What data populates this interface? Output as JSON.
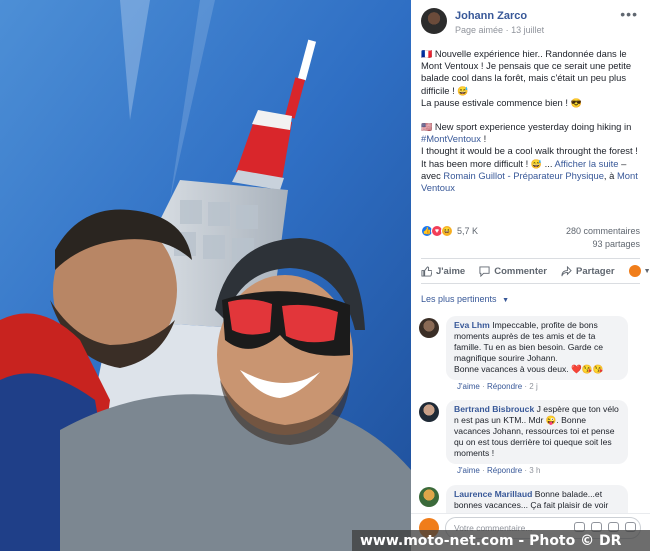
{
  "post": {
    "author": "Johann Zarco",
    "page_label": "Page aimée",
    "date": "13 juillet",
    "more_label": "•••",
    "text": {
      "fr_line1_flag": "🇫🇷",
      "fr_line1": "Nouvelle expérience hier.. Randonnée dans le Mont Ventoux ! Je pensais que ce serait une petite balade cool dans la forêt, mais c'était un peu plus difficile !",
      "fr_emoji1": "😅",
      "fr_line2": "La pause estivale commence bien !",
      "fr_emoji2": "😎",
      "en_flag": "🇺🇸",
      "en_line1": "New sport experience yesterday doing hiking in",
      "hashtag": "#MontVentoux",
      "en_line1_end": "!",
      "en_line2": "I thought it would be a cool walk throught the forest ! It has been more difficult !",
      "en_emoji": "😅",
      "ellipsis": "...",
      "see_more": "Afficher la suite",
      "dash": "–",
      "with_label": "avec",
      "tag1": "Romain Guillot - Préparateur Physique",
      "at_label": ", à",
      "place": "Mont Ventoux"
    }
  },
  "stats": {
    "reactions_count": "5,7 K",
    "comments": "280 commentaires",
    "shares": "93 partages",
    "reaction_icons": [
      "like-icon",
      "love-icon",
      "haha-icon"
    ]
  },
  "actions": {
    "like": "J'aime",
    "comment": "Commenter",
    "share": "Partager"
  },
  "sort_label": "Les plus pertinents",
  "comments": [
    {
      "name": "Eva Lhm",
      "text": "Impeccable, profite de bons moments auprès de tes amis et de ta famille. Tu en as bien besoin. Garde ce magnifique sourire Johann.",
      "text2": "Bonne vacances à vous deux.",
      "emojis": "❤️😘😘",
      "like": "J'aime",
      "reply": "Répondre",
      "age": "2 j"
    },
    {
      "name": "Bertrand Bisbrouck",
      "text": "J espère que ton vélo n est pas un KTM.. Mdr",
      "emoji": "😜",
      "text2": ". Bonne vacances Johann, ressources toi et pense qu on est tous derrière toi queque soit les moments !",
      "like": "J'aime",
      "reply": "Répondre",
      "age": "3 h"
    },
    {
      "name": "Laurence Marillaud",
      "text": "Bonne balade...et bonnes vacances... Ça fait plaisir de voir que"
    }
  ],
  "compose_placeholder": "Votre commentaire...",
  "watermark": "www.moto-net.com - Photo © DR",
  "colors": {
    "link": "#385898",
    "sky": "#2f6fc4",
    "tower_red": "#d9262b",
    "moto_orange": "#f07d1a"
  }
}
